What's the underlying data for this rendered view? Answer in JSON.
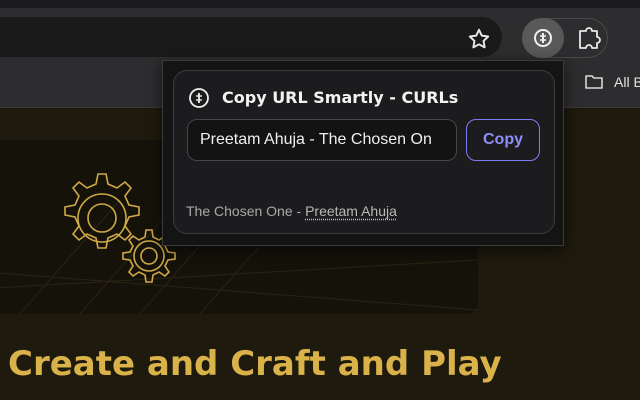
{
  "browser": {
    "bookmarks_bar": {
      "folder_label": "All B",
      "folder_icon": "folder-icon"
    },
    "toolbar": {
      "bookmark_icon": "star-icon",
      "extension_icon": "curls-icon",
      "extensions_icon": "puzzle-icon"
    }
  },
  "popup": {
    "title": "Copy URL Smartly - CURLs",
    "input_value": "Preetam Ahuja - The Chosen On",
    "copy_label": "Copy",
    "footer": {
      "prefix": "The Chosen One - ",
      "link": "Preetam Ahuja"
    },
    "accent_color": "#8e8ef8"
  },
  "page": {
    "headline": "Create and Craft and Play",
    "accent_color": "#d9b24a"
  }
}
